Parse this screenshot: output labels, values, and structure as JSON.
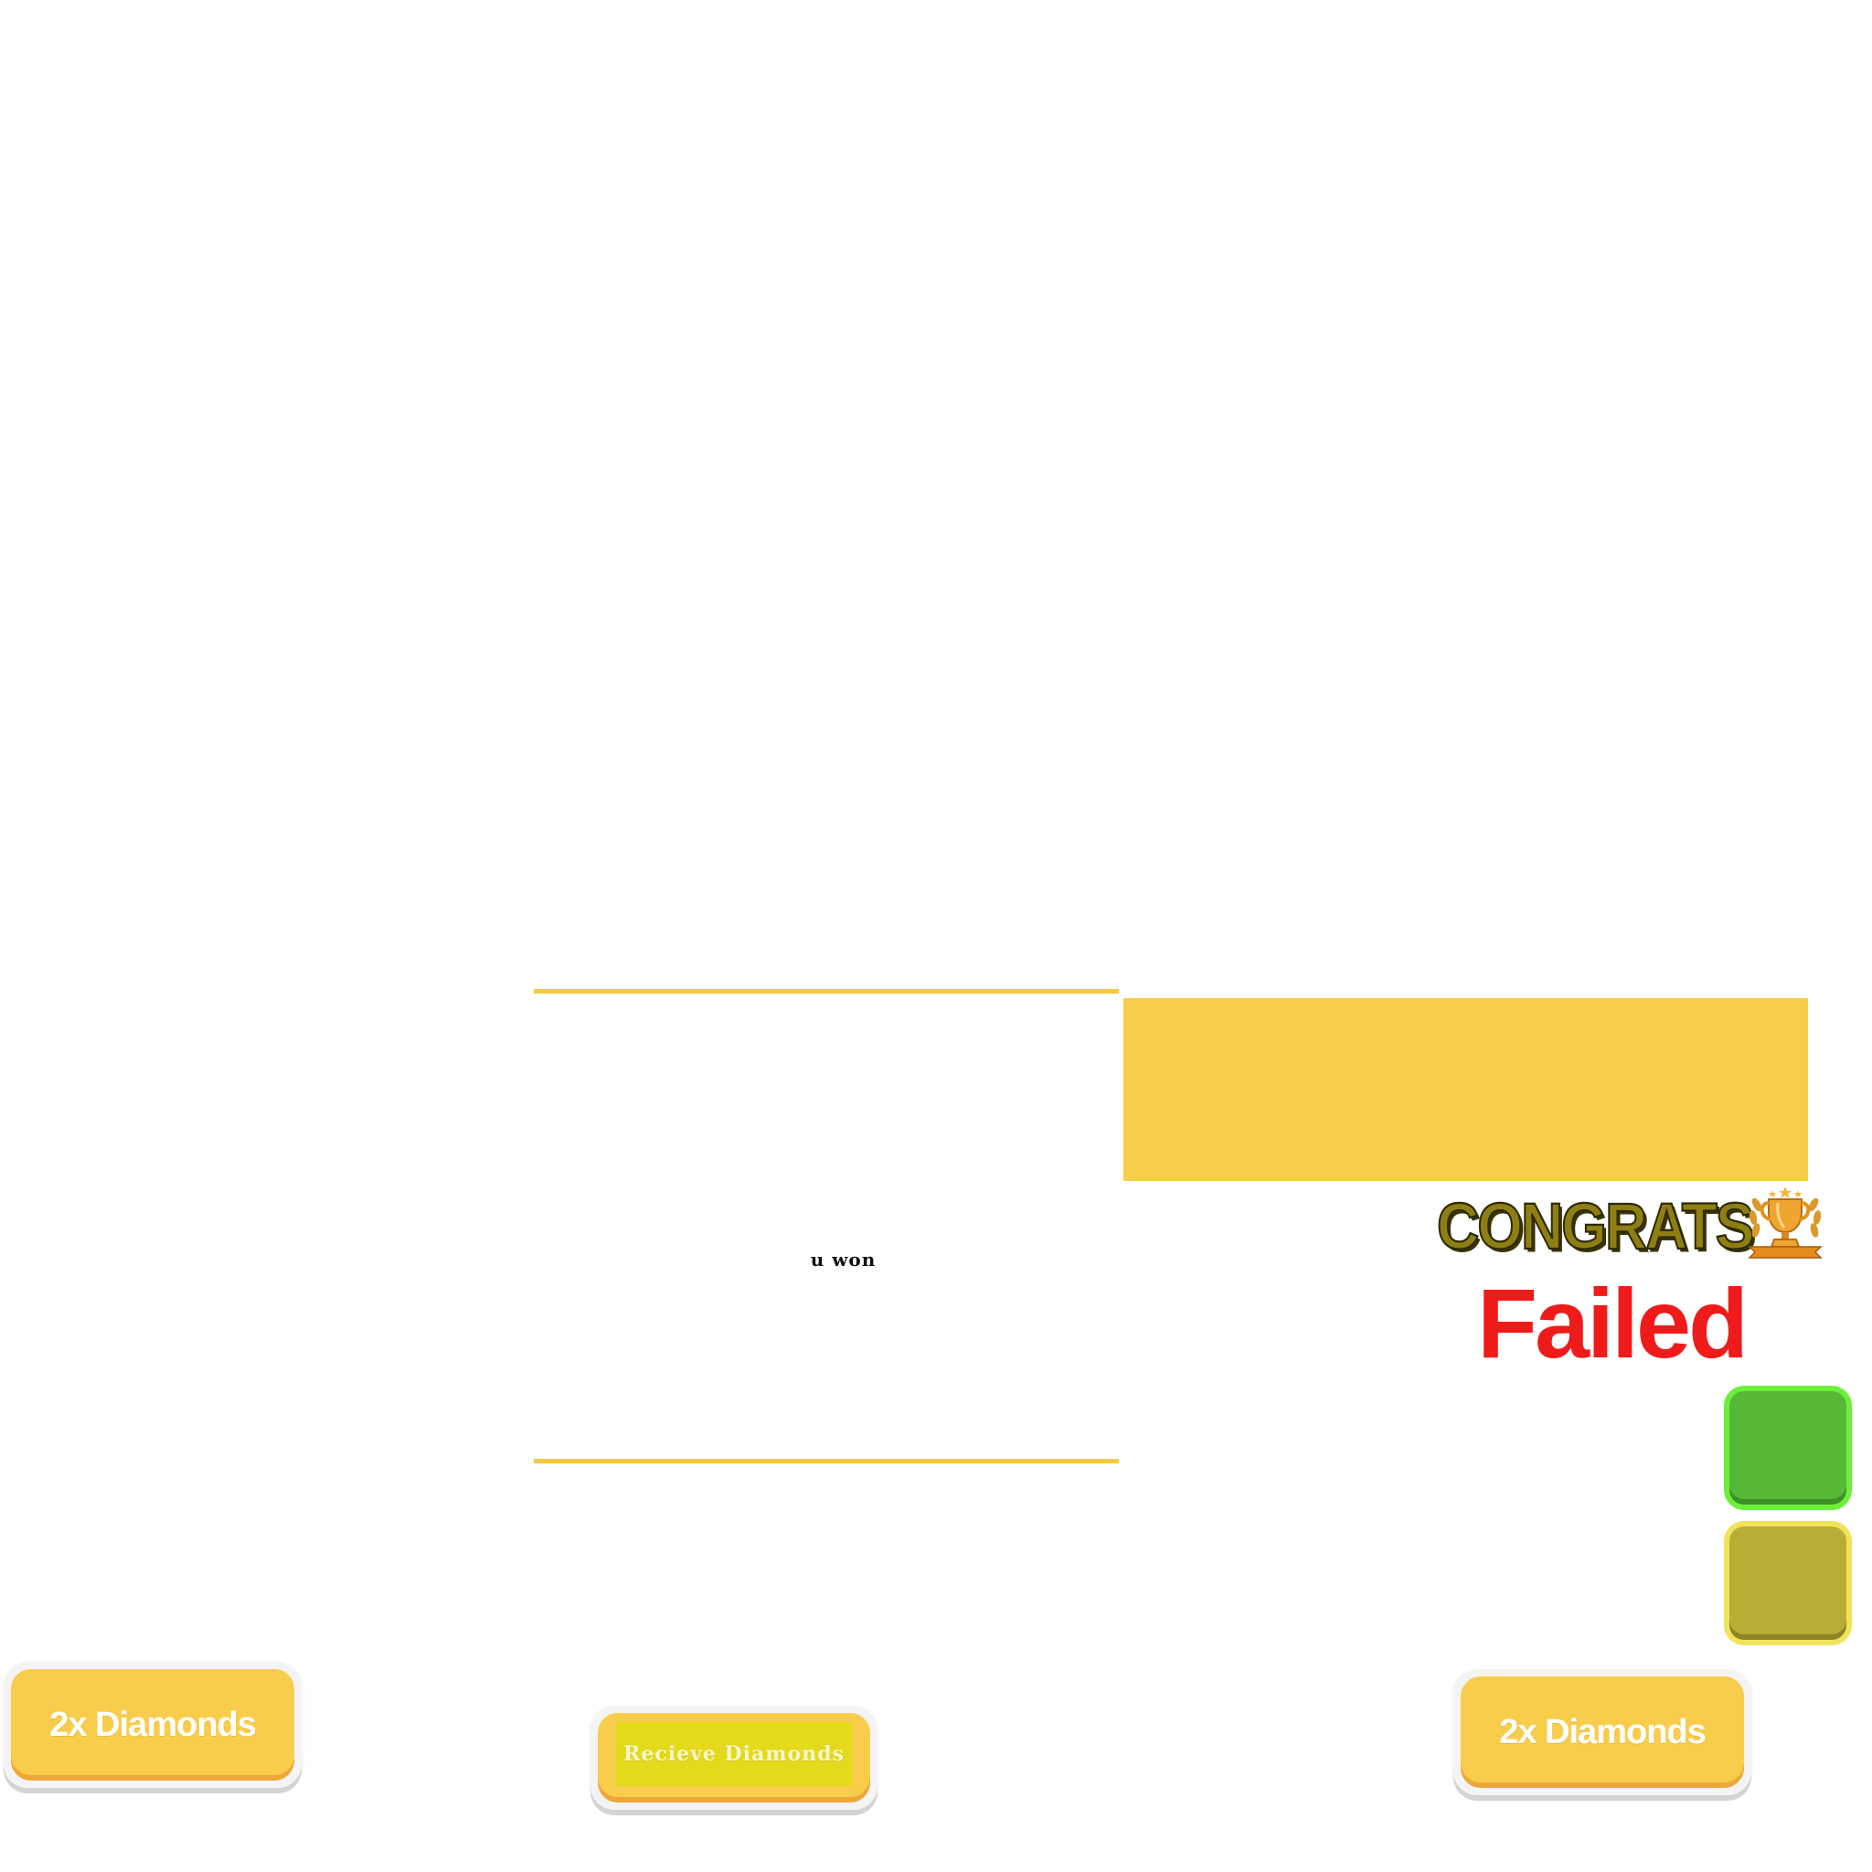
{
  "result_panel": {
    "won_text": "u won"
  },
  "titles": {
    "congrats": "CONGRATS",
    "failed": "Failed"
  },
  "icons": {
    "trophy": "trophy-icon"
  },
  "buttons": {
    "double_left": "2x Diamonds",
    "receive": "Recieve Diamonds",
    "double_right": "2x Diamonds"
  },
  "colors": {
    "accent_yellow": "#f8cd4b",
    "button_shadow_orange": "#eea83a",
    "congrats_olive": "#8f7f12",
    "failed_red": "#ef1b1b",
    "tile_green": "#55b836",
    "tile_olive": "#b8ae36",
    "receive_inner": "#e3da1c"
  }
}
